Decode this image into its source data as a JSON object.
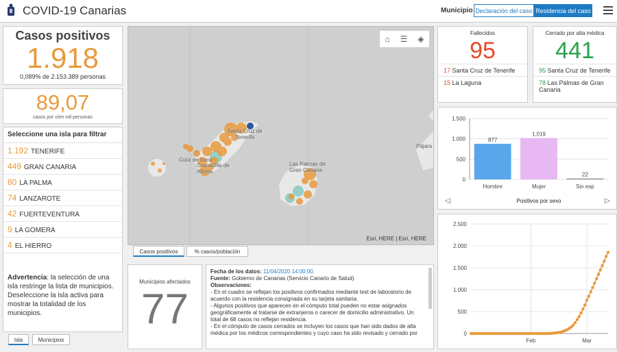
{
  "header": {
    "title": "COVID-19 Canarias",
    "municipio_label": "Municipio",
    "btn_declaracion": "Declaración del caso",
    "btn_residencia": "Residencia del caso"
  },
  "casos": {
    "title": "Casos positivos",
    "value": "1.918",
    "sub": "0,089% de 2.153.389 personas"
  },
  "rate": {
    "value": "89,07",
    "sub": "casos por cien mil personas"
  },
  "islands": {
    "title": "Seleccione una isla para filtrar",
    "items": [
      {
        "count": "1.192",
        "name": "TENERIFE"
      },
      {
        "count": "449",
        "name": "GRAN CANARIA"
      },
      {
        "count": "80",
        "name": "LA PALMA"
      },
      {
        "count": "74",
        "name": "LANZAROTE"
      },
      {
        "count": "42",
        "name": "FUERTEVENTURA"
      },
      {
        "count": "9",
        "name": "LA GOMERA"
      },
      {
        "count": "4",
        "name": "EL HIERRO"
      }
    ],
    "warning_bold": "Advertencia",
    "warning_text": ": la selección de una isla restringe la lista de municipios. Deseleccione la isla activa para mostrar la totalidad de los municipios."
  },
  "left_tabs": [
    "Isla",
    "Municipios"
  ],
  "map": {
    "labels": [
      "Santa Cruz de Tenerife",
      "Güía de Isora",
      "Granadilla de Abona",
      "Las Palmas de Gran Canaria",
      "Pájara"
    ],
    "attribution": "Esri, HERE | Esri, HERE",
    "tabs": [
      "Casos positivos",
      "% casos/población"
    ]
  },
  "municipios": {
    "title": "Municipios afectados",
    "value": "77"
  },
  "info": {
    "fecha_label": "Fecha de los datos:",
    "fecha_value": "11/04/2020 14:00:00.",
    "fuente_label": "Fuente:",
    "fuente_value": "Gobierno de Canarias (Servicio Canario de Salud)",
    "obs_label": "Observaciones:",
    "lines": [
      "- En el cuadro se reflejan los positivos confirmados mediante test de laboratorio de acuerdo con la residencia consignada en su tarjeta sanitaria.",
      "- Algunos positivos que aparecen en el cómputo total pueden no estar asignados geográficamente al tratarse de extranjeros o carecer de domicilio administrativo. Un total de 68 casos no reflejan residencia.",
      "- En el cómputo de casos cerrados se incluyen los casos que han sido dados de alta médica por los médicos correspondientes y cuyo caso ha sido revisado y cerrado por"
    ]
  },
  "fallecidos": {
    "title": "Fallecidos",
    "value": "95",
    "rows": [
      {
        "n": "17",
        "name": "Santa Cruz de Tenerife"
      },
      {
        "n": "15",
        "name": "La Laguna"
      }
    ]
  },
  "cerrado": {
    "title": "Cerrado por alta médica",
    "value": "441",
    "rows": [
      {
        "n": "95",
        "name": "Santa Cruz de Tenerife"
      },
      {
        "n": "78",
        "name": "Las Palmas de Gran Canaria"
      }
    ]
  },
  "colors": {
    "accent": "#1e7bc4",
    "orange": "#e89a3c",
    "red": "#e8492a",
    "green": "#2aa04a"
  },
  "chart_data": [
    {
      "type": "bar",
      "categories": [
        "Hombre",
        "Mujer",
        "Sin esp"
      ],
      "values": [
        877,
        1019,
        22
      ],
      "value_labels": [
        "877",
        "1.019",
        "22"
      ],
      "bar_colors": [
        "#5aa6ea",
        "#e8b8f2",
        "#888888"
      ],
      "xlabel": "Positivos por sexo",
      "ylim": [
        0,
        1500
      ],
      "yticks": [
        0,
        500,
        1000,
        1500
      ],
      "ytick_labels": [
        "0",
        "500",
        "1.000",
        "1.500"
      ]
    },
    {
      "type": "line",
      "x": [
        1,
        2,
        3,
        4,
        5,
        6,
        7,
        8,
        9,
        10,
        11,
        12,
        13,
        14,
        15,
        16,
        17,
        18,
        19,
        20,
        21,
        22,
        23,
        24,
        25,
        26,
        27,
        28,
        29,
        30,
        31,
        32,
        33,
        34,
        35,
        36,
        37,
        38,
        39,
        40,
        41,
        42,
        43,
        44,
        45,
        46,
        47,
        48,
        49,
        50,
        51,
        52,
        53,
        54,
        55,
        56,
        57,
        58,
        59,
        60,
        61,
        62,
        63,
        64,
        65,
        66,
        67,
        68,
        69,
        70,
        71,
        72
      ],
      "values": [
        0,
        0,
        0,
        0,
        0,
        0,
        0,
        0,
        0,
        0,
        0,
        0,
        0,
        0,
        0,
        0,
        0,
        0,
        0,
        0,
        0,
        0,
        0,
        0,
        0,
        0,
        0,
        0,
        0,
        0,
        0,
        0,
        0,
        0,
        0,
        0,
        0,
        0,
        0,
        0,
        0,
        0,
        6,
        10,
        14,
        20,
        28,
        40,
        55,
        72,
        90,
        120,
        150,
        195,
        250,
        320,
        390,
        470,
        560,
        650,
        760,
        850,
        950,
        1050,
        1150,
        1250,
        1350,
        1450,
        1550,
        1650,
        1760,
        1850
      ],
      "xtick_labels": [
        "Feb",
        "Mar"
      ],
      "xtick_positions": [
        32,
        61
      ],
      "ylim": [
        0,
        2500
      ],
      "yticks": [
        0,
        500,
        1000,
        1500,
        2000,
        2500
      ],
      "ytick_labels": [
        "0",
        "500",
        "1.000",
        "1.500",
        "2.000",
        "2.500"
      ],
      "line_color": "#e89a3c"
    }
  ]
}
